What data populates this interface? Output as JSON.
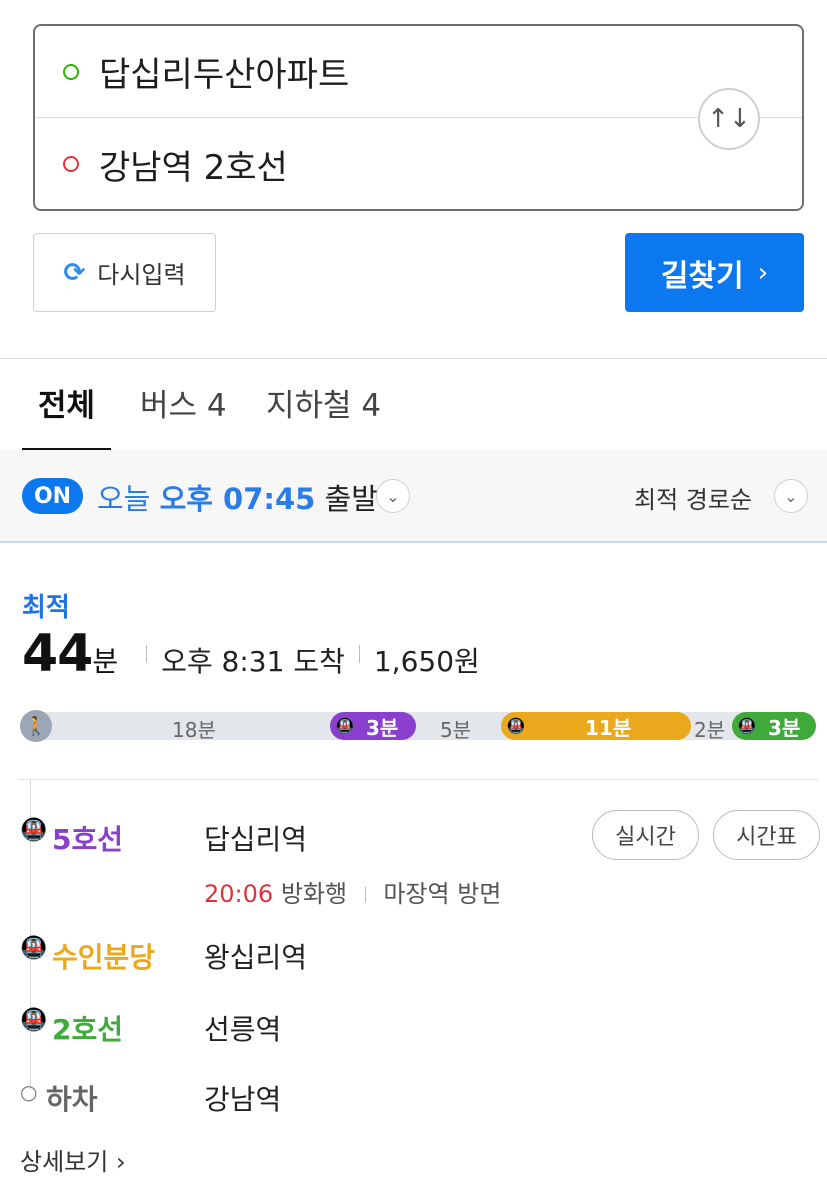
{
  "search": {
    "origin": "답십리두산아파트",
    "destination": "강남역 2호선",
    "swap_icon": "↑↓",
    "reset_label": "다시입력",
    "reset_icon": "⟳",
    "find_label": "길찾기",
    "find_chevron": "›"
  },
  "tabs": [
    {
      "label": "전체"
    },
    {
      "label": "버스 4"
    },
    {
      "label": "지하철 4"
    }
  ],
  "options": {
    "on_badge": "ON",
    "today": "오늘",
    "time": "오후 07:45",
    "depart_word": "출발",
    "sort_label": "최적 경로순"
  },
  "route": {
    "badge": "최적",
    "duration_num": "44",
    "duration_unit": "분",
    "arrival": "오후 8:31 도착",
    "fare": "1,650원",
    "segments": [
      {
        "type": "walk",
        "label": "18분",
        "color": "#9ca6b4"
      },
      {
        "type": "subway",
        "label": "3분",
        "color": "#8a3fcf"
      },
      {
        "type": "walk",
        "label": "5분",
        "color": "#e3e6ea"
      },
      {
        "type": "subway",
        "label": "11분",
        "color": "#eaa81c"
      },
      {
        "type": "walk",
        "label": "2분",
        "color": "#e3e6ea"
      },
      {
        "type": "subway",
        "label": "3분",
        "color": "#3eaa3a"
      }
    ],
    "steps": [
      {
        "line": "5호선",
        "station": "답십리역",
        "color": "#8a3fcf"
      },
      {
        "line": "수인분당",
        "station": "왕십리역",
        "color": "#eaa81c"
      },
      {
        "line": "2호선",
        "station": "선릉역",
        "color": "#3eaa3a"
      },
      {
        "line": "하차",
        "station": "강남역",
        "color": "#666666"
      }
    ],
    "first_step_detail": {
      "time": "20:06",
      "direction": "방화행",
      "via": "마장역 방면"
    },
    "realtime_label": "실시간",
    "timetable_label": "시간표",
    "more_label": "상세보기 ›"
  }
}
